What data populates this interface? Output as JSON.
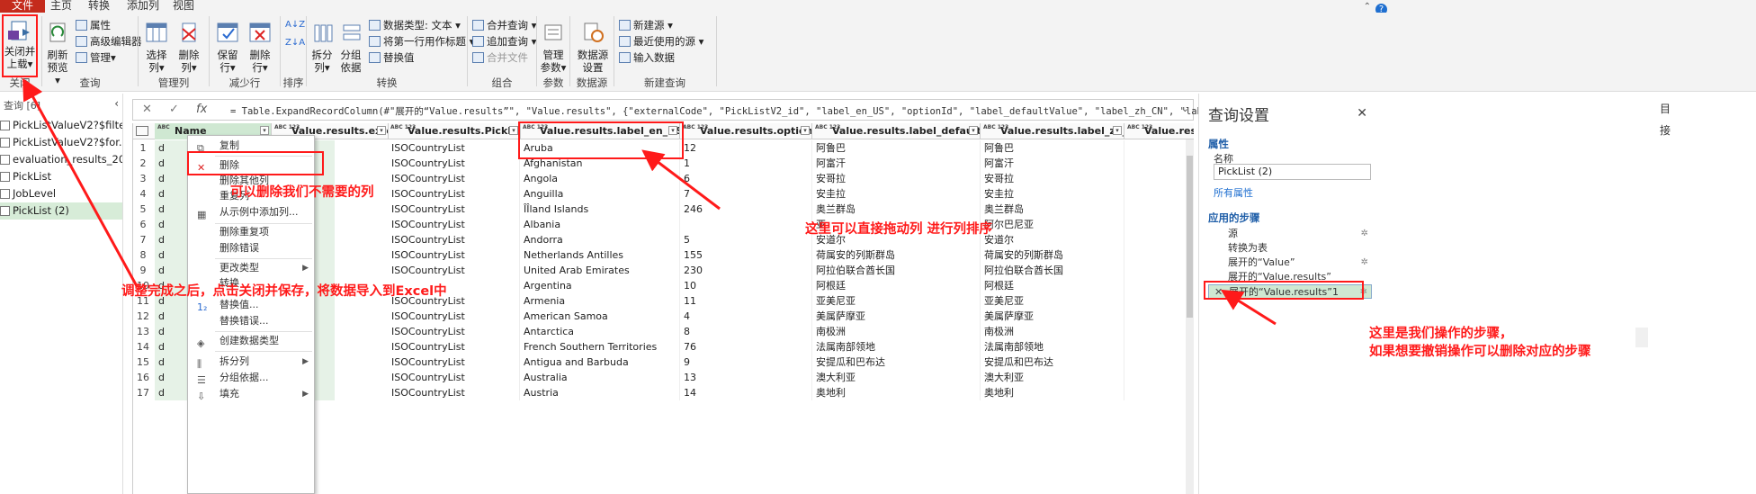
{
  "tabs": [
    "文件",
    "主页",
    "转换",
    "添加列",
    "视图"
  ],
  "ribbon": {
    "close": {
      "label1": "关闭并",
      "label2": "上载▾",
      "group": "关闭"
    },
    "query": {
      "refresh1": "刷新",
      "refresh2": "预览▾",
      "properties": "属性",
      "advanced": "高级编辑器",
      "manage": "管理▾",
      "group": "查询"
    },
    "cols": {
      "choose1": "选择",
      "choose2": "列▾",
      "remove1": "删除",
      "remove2": "列▾",
      "group": "管理列"
    },
    "rows": {
      "keep1": "保留",
      "keep2": "行▾",
      "delete1": "删除",
      "delete2": "行▾",
      "group": "减少行"
    },
    "sort": {
      "group": "排序"
    },
    "transform": {
      "split1": "拆分",
      "split2": "列▾",
      "groupby1": "分组",
      "groupby2": "依据",
      "datatype": "数据类型: 文本 ▾",
      "firstrow": "将第一行用作标题 ▾",
      "replace": "替换值",
      "group": "转换"
    },
    "combine": {
      "merge": "合并查询 ▾",
      "append": "追加查询 ▾",
      "files": "合并文件",
      "group": "组合"
    },
    "params": {
      "l1": "管理",
      "l2": "参数▾",
      "group": "参数"
    },
    "datasource": {
      "l1": "数据源",
      "l2": "设置",
      "group": "数据源"
    },
    "newquery": {
      "newsource": "新建源 ▾",
      "recent": "最近使用的源 ▾",
      "enter": "输入数据",
      "group": "新建查询"
    }
  },
  "left": {
    "header": "查询 [6]",
    "items": [
      "PickListValueV2?$filte...",
      "PickListValueV2?$for...",
      "evaluation_results_20...",
      "PickList",
      "JobLevel",
      "PickList (2)"
    ]
  },
  "formula": "= Table.ExpandRecordColumn(#\"展开的“Value.results”\", \"Value.results\", {\"externalCode\", \"PickListV2_id\", \"label_en_US\", \"optionId\", \"label_defaultValue\", \"label_zh_CN\", \"label_vi_VN\", \"label_th_TH\"},",
  "columns": [
    "Name",
    "Value.results.extern...",
    "Value.results.PickListV2_id",
    "Value.results.label_en_US",
    "Value.results.optionId",
    "Value.results.label_defaultValue",
    "Value.results.label_zh_CN",
    "Value.results.l"
  ],
  "col_types": [
    "ABC",
    "ABC 123",
    "ABC 123",
    "ABC 123",
    "ABC 123",
    "ABC 123",
    "ABC 123",
    "ABC 123"
  ],
  "rows": [
    [
      "1",
      "d",
      "ISOCountryList",
      "Aruba",
      "12",
      "阿鲁巴",
      "阿鲁巴"
    ],
    [
      "2",
      "d",
      "ISOCountryList",
      "Afghanistan",
      "1",
      "阿富汗",
      "阿富汗"
    ],
    [
      "3",
      "d",
      "ISOCountryList",
      "Angola",
      "6",
      "安哥拉",
      "安哥拉"
    ],
    [
      "4",
      "d",
      "ISOCountryList",
      "Anguilla",
      "7",
      "安圭拉",
      "安圭拉"
    ],
    [
      "5",
      "d",
      "ISOCountryList",
      "ÎÎland Islands",
      "246",
      "奥兰群岛",
      "奥兰群岛"
    ],
    [
      "6",
      "d",
      "ISOCountryList",
      "Albania",
      "",
      "亚",
      "阿尔巴尼亚"
    ],
    [
      "7",
      "d",
      "ISOCountryList",
      "Andorra",
      "5",
      "安道尔",
      "安道尔"
    ],
    [
      "8",
      "d",
      "ISOCountryList",
      "Netherlands Antilles",
      "155",
      "荷属安的列斯群岛",
      "荷属安的列斯群岛"
    ],
    [
      "9",
      "d",
      "ISOCountryList",
      "United Arab Emirates",
      "230",
      "阿拉伯联合酋长国",
      "阿拉伯联合酋长国"
    ],
    [
      "10",
      "d",
      "",
      "Argentina",
      "10",
      "阿根廷",
      "阿根廷"
    ],
    [
      "11",
      "d",
      "ISOCountryList",
      "Armenia",
      "11",
      "亚美尼亚",
      "亚美尼亚"
    ],
    [
      "12",
      "d",
      "ISOCountryList",
      "American Samoa",
      "4",
      "美属萨摩亚",
      "美属萨摩亚"
    ],
    [
      "13",
      "d",
      "ISOCountryList",
      "Antarctica",
      "8",
      "南极洲",
      "南极洲"
    ],
    [
      "14",
      "d",
      "ISOCountryList",
      "French Southern Territories",
      "76",
      "法属南部领地",
      "法属南部领地"
    ],
    [
      "15",
      "d",
      "ISOCountryList",
      "Antigua and Barbuda",
      "9",
      "安提瓜和巴布达",
      "安提瓜和巴布达"
    ],
    [
      "16",
      "d",
      "ISOCountryList",
      "Australia",
      "13",
      "澳大利亚",
      "澳大利亚"
    ],
    [
      "17",
      "d",
      "ISOCountryList",
      "Austria",
      "14",
      "奥地利",
      "奥地利"
    ]
  ],
  "menu": [
    "复制",
    "删除",
    "删除其他列",
    "重复列",
    "从示例中添加列...",
    "删除重复项",
    "删除错误",
    "更改类型",
    "转换",
    "替换值...",
    "替换错误...",
    "创建数据类型",
    "拆分列",
    "分组依据...",
    "填充"
  ],
  "settings": {
    "title": "查询设置",
    "props": "属性",
    "name_label": "名称",
    "name_value": "PickList (2)",
    "all_props": "所有属性",
    "applied": "应用的步骤",
    "steps": [
      "源",
      "转换为表",
      "展开的“Value”",
      "展开的“Value.results”",
      "展开的“Value.results”1"
    ]
  },
  "farright": {
    "t1": "目",
    "t2": "接"
  },
  "annotations": {
    "delete_cols": "可以删除我们不需要的列",
    "drag_cols": "这里可以直接拖动列 进行列排序",
    "close_save": "调整完成之后，点击关闭并保存，将数据导入到Excel中",
    "steps_1": "这里是我们操作的步骤，",
    "steps_2": "如果想要撤销操作可以删除对应的步骤"
  }
}
